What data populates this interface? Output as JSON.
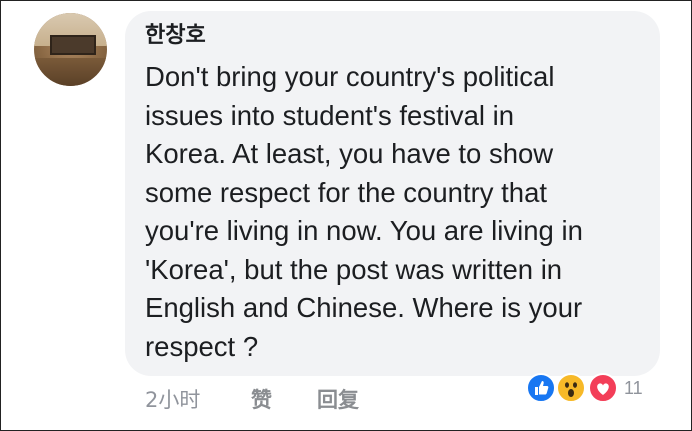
{
  "comment": {
    "author": "한창호",
    "text": "Don't bring your country's political\nissues into student's festival in\nKorea. At least, you have to show\nsome respect for the country that\nyou're living in now. You are living in\n'Korea', but the post was written in\nEnglish and Chinese. Where is your\nrespect ?",
    "timestamp": "2小时",
    "like_label": "赞",
    "reply_label": "回复",
    "reactions": {
      "icons": [
        "like-icon",
        "wow-icon",
        "love-icon"
      ],
      "count": "11"
    }
  },
  "colors": {
    "bubble": "#f2f3f5",
    "text": "#1c1e21",
    "meta": "#90949c",
    "like": "#1877f2",
    "wow": "#f7b928",
    "love": "#f33e58"
  }
}
